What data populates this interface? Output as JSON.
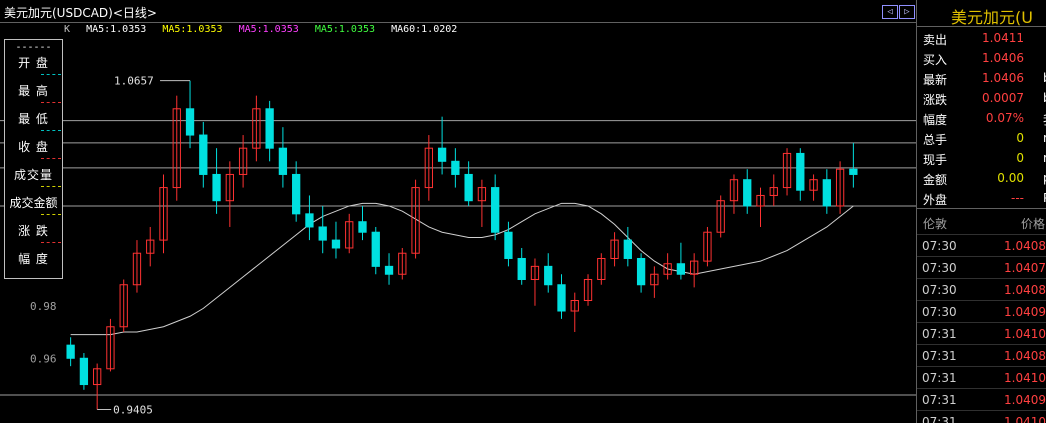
{
  "header": {
    "title": "美元加元(USDCAD)<日线>",
    "nav_left": "◁",
    "nav_right": "▷"
  },
  "ma_bar": {
    "k": "K",
    "items": [
      {
        "text": "MA5:1.0353",
        "color": "#ffffff"
      },
      {
        "text": "MA5:1.0353",
        "color": "#ffff00"
      },
      {
        "text": "MA5:1.0353",
        "color": "#ff40ff"
      },
      {
        "text": "MA5:1.0353",
        "color": "#40ff40"
      },
      {
        "text": "MA60:1.0202",
        "color": "#ffffff"
      }
    ]
  },
  "info_box": {
    "dashes": "------",
    "items": [
      "开  盘",
      "最  高",
      "最  低",
      "收  盘",
      "成交量",
      "成交金额",
      "涨  跌",
      "幅  度"
    ]
  },
  "right_panel": {
    "title": "美元加元(U",
    "quote": [
      {
        "label": "卖出",
        "value": "1.0411",
        "color": "#ff4040",
        "extra": ""
      },
      {
        "label": "买入",
        "value": "1.0406",
        "color": "#ff4040",
        "extra": ""
      },
      {
        "label": "最新",
        "value": "1.0406",
        "color": "#ff4040",
        "extra": "b"
      },
      {
        "label": "涨跌",
        "value": "0.0007",
        "color": "#ff4040",
        "extra": "b"
      },
      {
        "label": "幅度",
        "value": "0.07%",
        "color": "#ff4040",
        "extra": "我"
      },
      {
        "label": "总手",
        "value": "0",
        "color": "#e0e000",
        "extra": "r"
      },
      {
        "label": "现手",
        "value": "0",
        "color": "#e0e000",
        "extra": "r"
      },
      {
        "label": "金额",
        "value": "0.00",
        "color": "#e0e000",
        "extra": "p"
      },
      {
        "label": "外盘",
        "value": "---",
        "color": "#ff4040",
        "extra": "P"
      }
    ],
    "ticks_header": {
      "left": "伦敦",
      "right": "价格"
    },
    "ticks": [
      {
        "time": "07:30",
        "price": "1.0408"
      },
      {
        "time": "07:30",
        "price": "1.0407"
      },
      {
        "time": "07:30",
        "price": "1.0408"
      },
      {
        "time": "07:30",
        "price": "1.0409"
      },
      {
        "time": "07:31",
        "price": "1.0410"
      },
      {
        "time": "07:31",
        "price": "1.0408"
      },
      {
        "time": "07:31",
        "price": "1.0410"
      },
      {
        "time": "07:31",
        "price": "1.0409"
      },
      {
        "time": "07:31",
        "price": "1.0410"
      }
    ]
  },
  "chart_data": {
    "type": "candlestick",
    "title": "美元加元(USDCAD)<日线>",
    "ylim": [
      0.9365,
      1.085
    ],
    "y_ticks": [
      0.96,
      0.98
    ],
    "high_label": "1.0657",
    "low_label": "0.9405",
    "max_value": 1.0657,
    "min_value": 0.9405,
    "last_close": 1.0406,
    "level_lines": [
      1.0505,
      1.042,
      1.0325,
      1.018,
      0.946
    ],
    "grid": false,
    "ohlc": [
      [
        0.965,
        0.968,
        0.957,
        0.96
      ],
      [
        0.96,
        0.962,
        0.948,
        0.95
      ],
      [
        0.95,
        0.958,
        0.9405,
        0.956
      ],
      [
        0.956,
        0.975,
        0.955,
        0.972
      ],
      [
        0.972,
        0.99,
        0.97,
        0.988
      ],
      [
        0.988,
        1.005,
        0.985,
        1.0
      ],
      [
        1.0,
        1.01,
        0.995,
        1.005
      ],
      [
        1.005,
        1.03,
        1.0,
        1.025
      ],
      [
        1.025,
        1.06,
        1.02,
        1.055
      ],
      [
        1.055,
        1.0657,
        1.04,
        1.045
      ],
      [
        1.045,
        1.05,
        1.025,
        1.03
      ],
      [
        1.03,
        1.04,
        1.015,
        1.02
      ],
      [
        1.02,
        1.035,
        1.01,
        1.03
      ],
      [
        1.03,
        1.045,
        1.025,
        1.04
      ],
      [
        1.04,
        1.06,
        1.035,
        1.055
      ],
      [
        1.055,
        1.058,
        1.035,
        1.04
      ],
      [
        1.04,
        1.048,
        1.025,
        1.03
      ],
      [
        1.03,
        1.035,
        1.012,
        1.015
      ],
      [
        1.015,
        1.022,
        1.005,
        1.01
      ],
      [
        1.01,
        1.018,
        1.0,
        1.005
      ],
      [
        1.005,
        1.012,
        0.998,
        1.002
      ],
      [
        1.002,
        1.015,
        1.0,
        1.012
      ],
      [
        1.012,
        1.018,
        1.005,
        1.008
      ],
      [
        1.008,
        1.01,
        0.992,
        0.995
      ],
      [
        0.995,
        1.0,
        0.988,
        0.992
      ],
      [
        0.992,
        1.002,
        0.99,
        1.0
      ],
      [
        1.0,
        1.028,
        0.998,
        1.025
      ],
      [
        1.025,
        1.045,
        1.02,
        1.04
      ],
      [
        1.04,
        1.052,
        1.03,
        1.035
      ],
      [
        1.035,
        1.04,
        1.025,
        1.03
      ],
      [
        1.03,
        1.035,
        1.018,
        1.02
      ],
      [
        1.02,
        1.028,
        1.01,
        1.025
      ],
      [
        1.025,
        1.03,
        1.005,
        1.008
      ],
      [
        1.008,
        1.012,
        0.995,
        0.998
      ],
      [
        0.998,
        1.002,
        0.988,
        0.99
      ],
      [
        0.99,
        0.998,
        0.98,
        0.995
      ],
      [
        0.995,
        1.0,
        0.985,
        0.988
      ],
      [
        0.988,
        0.992,
        0.975,
        0.978
      ],
      [
        0.978,
        0.985,
        0.97,
        0.982
      ],
      [
        0.982,
        0.992,
        0.98,
        0.99
      ],
      [
        0.99,
        1.0,
        0.988,
        0.998
      ],
      [
        0.998,
        1.008,
        0.995,
        1.005
      ],
      [
        1.005,
        1.01,
        0.995,
        0.998
      ],
      [
        0.998,
        1.0,
        0.985,
        0.988
      ],
      [
        0.988,
        0.995,
        0.983,
        0.992
      ],
      [
        0.992,
        1.0,
        0.99,
        0.996
      ],
      [
        0.996,
        1.004,
        0.99,
        0.992
      ],
      [
        0.992,
        1.0,
        0.987,
        0.997
      ],
      [
        0.997,
        1.01,
        0.995,
        1.008
      ],
      [
        1.008,
        1.022,
        1.006,
        1.02
      ],
      [
        1.02,
        1.03,
        1.015,
        1.028
      ],
      [
        1.028,
        1.032,
        1.015,
        1.018
      ],
      [
        1.018,
        1.025,
        1.01,
        1.022
      ],
      [
        1.022,
        1.03,
        1.018,
        1.025
      ],
      [
        1.025,
        1.04,
        1.022,
        1.038
      ],
      [
        1.038,
        1.04,
        1.02,
        1.024
      ],
      [
        1.024,
        1.03,
        1.02,
        1.028
      ],
      [
        1.028,
        1.032,
        1.015,
        1.018
      ],
      [
        1.018,
        1.035,
        1.015,
        1.032
      ],
      [
        1.032,
        1.042,
        1.025,
        1.03
      ]
    ],
    "ma60": [
      0.969,
      0.969,
      0.969,
      0.969,
      0.97,
      0.97,
      0.971,
      0.972,
      0.974,
      0.976,
      0.979,
      0.983,
      0.987,
      0.991,
      0.995,
      0.999,
      1.003,
      1.007,
      1.011,
      1.014,
      1.016,
      1.018,
      1.019,
      1.019,
      1.018,
      1.016,
      1.013,
      1.01,
      1.008,
      1.007,
      1.006,
      1.006,
      1.007,
      1.009,
      1.012,
      1.015,
      1.017,
      1.019,
      1.019,
      1.018,
      1.015,
      1.011,
      1.006,
      1.001,
      0.997,
      0.994,
      0.993,
      0.992,
      0.993,
      0.994,
      0.995,
      0.996,
      0.997,
      0.999,
      1.001,
      1.004,
      1.007,
      1.01,
      1.014,
      1.018
    ]
  }
}
